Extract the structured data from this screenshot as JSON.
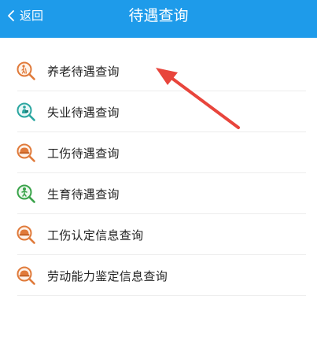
{
  "header": {
    "back_label": "返回",
    "title": "待遇查询"
  },
  "colors": {
    "header_bg": "#1e9bea",
    "pointer_arrow": "#e8453c"
  },
  "items": [
    {
      "label": "养老待遇查询",
      "icon": "elderly-magnifier-icon",
      "color": "#e07a3a"
    },
    {
      "label": "失业待遇查询",
      "icon": "unemployment-magnifier-icon",
      "color": "#2aa6a0"
    },
    {
      "label": "工伤待遇查询",
      "icon": "hardhat-magnifier-icon",
      "color": "#e07a3a"
    },
    {
      "label": "生育待遇查询",
      "icon": "baby-magnifier-icon",
      "color": "#3aa34a"
    },
    {
      "label": "工伤认定信息查询",
      "icon": "hardhat-magnifier-icon",
      "color": "#e07a3a"
    },
    {
      "label": "劳动能力鉴定信息查询",
      "icon": "hardhat-magnifier-icon",
      "color": "#e07a3a"
    }
  ]
}
